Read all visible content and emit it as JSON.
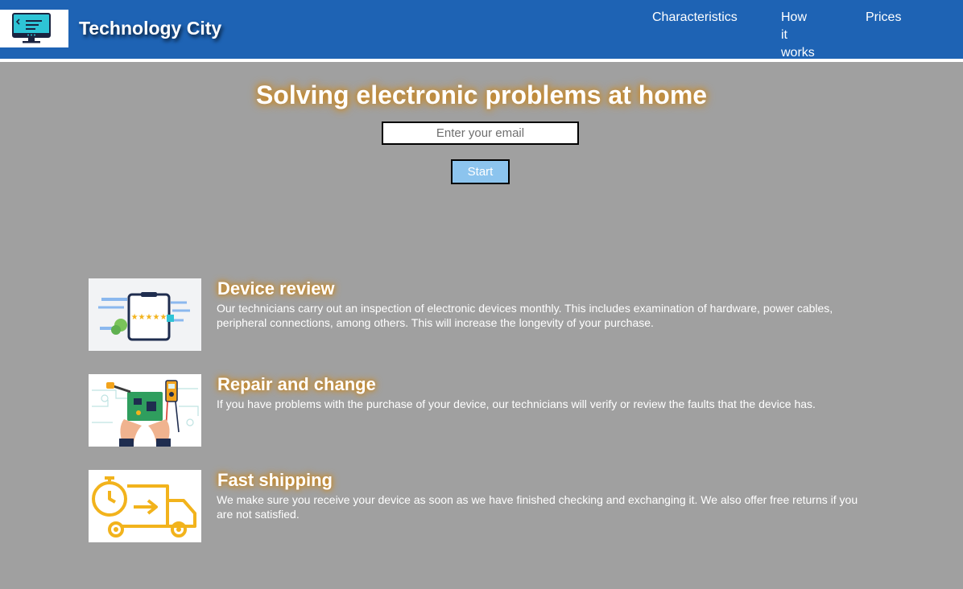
{
  "header": {
    "brand": "Technology City",
    "logo_icon": "computer-monitor-icon",
    "nav": [
      {
        "label": "Characteristics"
      },
      {
        "label": "How it works"
      },
      {
        "label": "Prices"
      }
    ]
  },
  "hero": {
    "title": "Solving electronic problems at home",
    "email_placeholder": "Enter your email",
    "start_label": "Start"
  },
  "features": [
    {
      "icon": "tablet-review-icon",
      "title": "Device review",
      "description": "Our technicians carry out an inspection of electronic devices monthly. This includes examination of hardware, power cables, peripheral connections, among others. This will increase the longevity of your purchase."
    },
    {
      "icon": "circuit-repair-icon",
      "title": "Repair and change",
      "description": "If you have problems with the purchase of your device, our technicians will verify or review the faults that the device has."
    },
    {
      "icon": "delivery-truck-icon",
      "title": "Fast shipping",
      "description": "We make sure you receive your device as soon as we have finished checking and exchanging it. We also offer free returns if you are not satisfied."
    }
  ],
  "colors": {
    "header_bg": "#1e63b4",
    "page_bg": "#a0a0a0",
    "button_bg": "#8cc4ee",
    "title_glow": "#e0981a"
  }
}
